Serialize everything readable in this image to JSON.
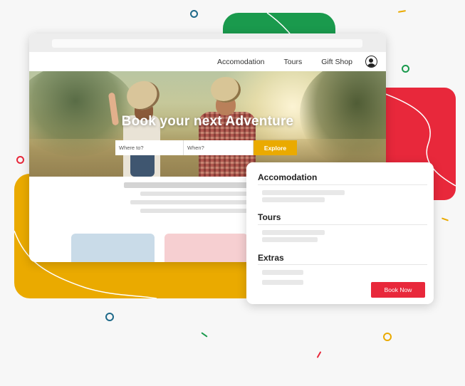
{
  "site": {
    "nav": {
      "accommodation": "Accomodation",
      "tours": "Tours",
      "gift_shop": "Gift Shop",
      "profile_icon": "user-circle-icon"
    },
    "hero": {
      "title": "Book your next Adventure",
      "where_placeholder": "Where to?",
      "when_placeholder": "When?",
      "explore_label": "Explore"
    }
  },
  "panel": {
    "sections": {
      "accommodation": "Accomodation",
      "tours": "Tours",
      "extras": "Extras"
    },
    "book_now_label": "Book Now"
  },
  "colors": {
    "accent_yellow": "#eaaa00",
    "accent_red": "#e8283b",
    "accent_green": "#1a9a4d",
    "card_blue": "#c9dbe8",
    "card_pink": "#f6cfd1"
  }
}
